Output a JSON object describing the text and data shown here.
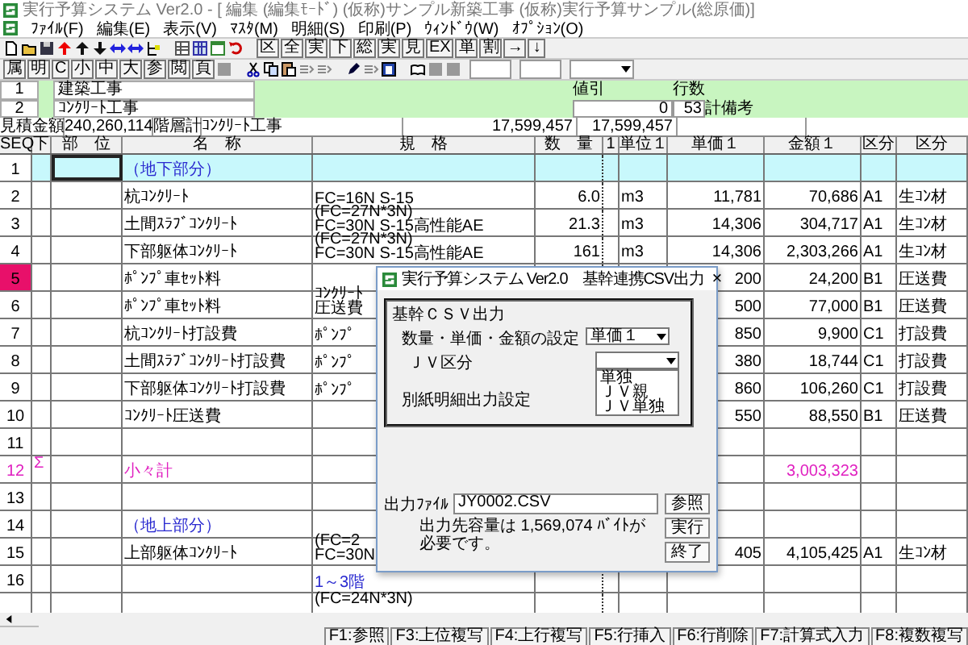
{
  "window": {
    "title": "実行予算システム Ver2.0 - [ 編集 (編集ﾓｰﾄﾞ) (仮称)サンプル新築工事 (仮称)実行予算サンプル(総原価)]"
  },
  "menu": [
    "ﾌｧｲﾙ(F)",
    "編集(E)",
    "表示(V)",
    "ﾏｽﾀ(M)",
    "明細(S)",
    "印刷(P)",
    "ｳｨﾝﾄﾞｳ(W)",
    "ｵﾌﾟｼｮﾝ(O)"
  ],
  "toolbar_1": [
    "区",
    "全",
    "実",
    "下",
    "総",
    "実",
    "見",
    "EX",
    "単",
    "割",
    "→",
    "↓"
  ],
  "toolbar_2": [
    "属",
    "明",
    "C",
    "小",
    "中",
    "大",
    "参",
    "閲",
    "頁"
  ],
  "hierarchy": [
    {
      "no": "1",
      "name": "建築工事"
    },
    {
      "no": "2",
      "name": "ｺﾝｸﾘｰﾄ工事"
    }
  ],
  "discount": {
    "label": "値引",
    "value": "0"
  },
  "row_count": {
    "label": "行数",
    "value": "53",
    "note": "計備考"
  },
  "estimate": {
    "label": "見積金額",
    "value": "240,260,114",
    "level_label": "階層計",
    "level_name": "ｺﾝｸﾘｰﾄ工事",
    "total_1": "17,599,457",
    "total_2": "17,599,457"
  },
  "columns": [
    "SEQ",
    "下",
    "部　位",
    "名　称",
    "規　格",
    "数　量",
    "1",
    "単位１",
    "単価１",
    "金額１",
    "区分",
    "区分"
  ],
  "rows": [
    {
      "kind": "heading",
      "seq": "1",
      "name": "（地下部分）",
      "current": true,
      "selected": false
    },
    {
      "kind": "item",
      "seq": "2",
      "name": "杭ｺﾝｸﾘｰﾄ",
      "spec": [
        "FC=16N S-15"
      ],
      "qty": "6.0",
      "unit": "m3",
      "price": "11,781",
      "amount": "70,686",
      "class": "A1",
      "class_name": "生ｺﾝ材",
      "current": false,
      "selected": false
    },
    {
      "kind": "item",
      "seq": "3",
      "name": "土間ｽﾗﾌﾞｺﾝｸﾘｰﾄ",
      "spec": [
        "(FC=27N*3N)",
        "FC=30N S-15高性能AE"
      ],
      "qty": "21.3",
      "unit": "m3",
      "price": "14,306",
      "amount": "304,717",
      "class": "A1",
      "class_name": "生ｺﾝ材",
      "current": false,
      "selected": false
    },
    {
      "kind": "item",
      "seq": "4",
      "name": "下部躯体ｺﾝｸﾘｰﾄ",
      "spec": [
        "(FC=27N*3N)",
        "FC=30N S-15高性能AE"
      ],
      "qty": "161",
      "unit": "m3",
      "price": "14,306",
      "amount": "2,303,266",
      "class": "A1",
      "class_name": "生ｺﾝ材",
      "current": false,
      "selected": false
    },
    {
      "kind": "item",
      "seq": "5",
      "name": "ﾎﾟﾝﾌﾟ車ｾｯﾄ料",
      "price": "200",
      "amount": "24,200",
      "class": "B1",
      "class_name": "圧送費",
      "current": false,
      "selected": true
    },
    {
      "kind": "item",
      "seq": "6",
      "name": "ﾎﾟﾝﾌﾟ車ｾｯﾄ料",
      "spec": [
        "ｺﾝｸﾘｰﾄ",
        "圧送費"
      ],
      "price": "500",
      "amount": "77,000",
      "class": "B1",
      "class_name": "圧送費",
      "current": false,
      "selected": false
    },
    {
      "kind": "item",
      "seq": "7",
      "name": "杭ｺﾝｸﾘｰﾄ打設費",
      "spec": [
        "ﾎﾟﾝﾌﾟ"
      ],
      "price": "850",
      "amount": "9,900",
      "class": "C1",
      "class_name": "打設費",
      "current": false,
      "selected": false
    },
    {
      "kind": "item",
      "seq": "8",
      "name": "土間ｽﾗﾌﾞｺﾝｸﾘｰﾄ打設費",
      "spec": [
        "ﾎﾟﾝﾌﾟ"
      ],
      "price": "380",
      "amount": "18,744",
      "class": "C1",
      "class_name": "打設費",
      "current": false,
      "selected": false
    },
    {
      "kind": "item",
      "seq": "9",
      "name": "下部躯体ｺﾝｸﾘｰﾄ打設費",
      "spec": [
        "ﾎﾟﾝﾌﾟ"
      ],
      "price": "860",
      "amount": "106,260",
      "class": "C1",
      "class_name": "打設費",
      "current": false,
      "selected": false
    },
    {
      "kind": "item",
      "seq": "10",
      "name": "ｺﾝｸﾘｰﾄ圧送費",
      "price": "550",
      "amount": "88,550",
      "class": "B1",
      "class_name": "圧送費",
      "current": false,
      "selected": false
    },
    {
      "kind": "blank",
      "seq": "11",
      "current": false,
      "selected": false
    },
    {
      "kind": "subtotal",
      "seq": "12",
      "mark": "Σ",
      "name": "小々計",
      "amount": "3,003,323",
      "current": false,
      "selected": false
    },
    {
      "kind": "blank",
      "seq": "13",
      "current": false,
      "selected": false
    },
    {
      "kind": "heading",
      "seq": "14",
      "name": "（地上部分）",
      "current": false,
      "selected": false
    },
    {
      "kind": "item",
      "seq": "15",
      "name": "上部躯体ｺﾝｸﾘｰﾄ",
      "spec": [
        "(FC=2",
        "FC=30N"
      ],
      "price": "405",
      "amount": "4,105,425",
      "class": "A1",
      "class_name": "生ｺﾝ材",
      "current": false,
      "selected": false
    },
    {
      "kind": "note",
      "seq": "16",
      "spec": [
        "1～3階"
      ],
      "current": false,
      "selected": false
    },
    {
      "kind": "item",
      "spec": [
        "(FC=24N*3N)"
      ],
      "current": false,
      "selected": false
    }
  ],
  "dialog": {
    "title": "実行予算システム Ver2.0　基幹連携CSV出力",
    "close": "×",
    "group": "基幹ＣＳＶ出力",
    "amount_label": "数量・単価・金額の設定",
    "amount_value": "単価１",
    "jv_label": "ＪＶ区分",
    "jv_options": [
      {
        "label": "単独",
        "selected": false
      },
      {
        "label": "ＪＶ親",
        "selected": false
      },
      {
        "label": "ＪＶ単独",
        "selected": false
      }
    ],
    "sheet_label": "別紙明細出力設定",
    "file_label": "出力ﾌｧｲﾙ",
    "file_value": "JY0002.CSV",
    "capacity": "出力先容量は 1,569,074 ﾊﾞｲﾄが必要です。",
    "buttons": [
      "参照",
      "実行",
      "終了"
    ]
  },
  "function_keys": [
    "F1:参照",
    "F3:上位複写",
    "F4:上行複写",
    "F5:行挿入",
    "F6:行削除",
    "F7:計算式入力",
    "F8:複数複写"
  ]
}
